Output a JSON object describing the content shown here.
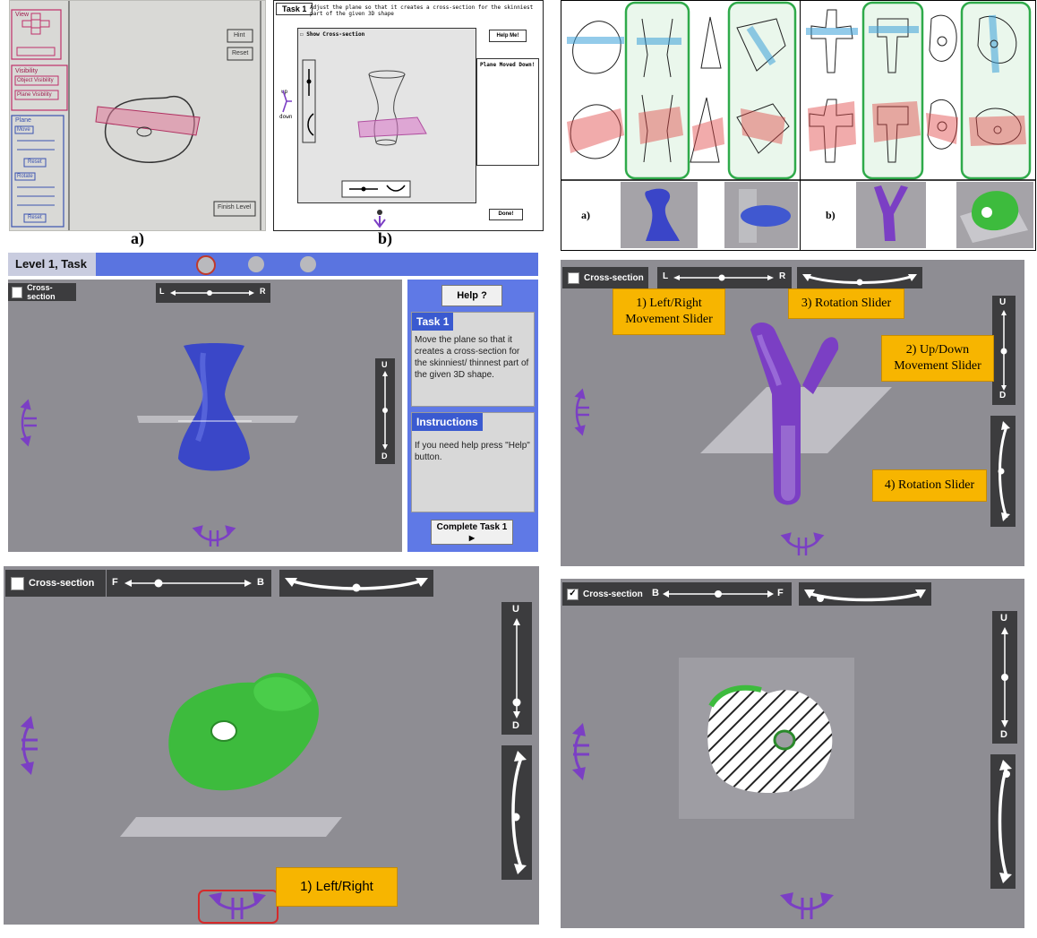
{
  "captions": {
    "top_sketch": "a)",
    "top_wireframe": "b)",
    "panel_a": "a)",
    "panel_b": "b)"
  },
  "paper_sketch": {
    "labels": [
      "View",
      "Hint",
      "Reset",
      "Visibility",
      "Object Visibility",
      "Plane Visibility",
      "Plane",
      "Move",
      "Reset",
      "Rotate",
      "Reset",
      "Finish Level"
    ]
  },
  "wireframe": {
    "task_title": "Task 1",
    "task_instruction": "Adjust the plane so that it creates a cross-section for the skinniest part of the given 3D shape",
    "show_cross_section": "Show Cross-section",
    "help_button": "Help Me!",
    "message": "Plane Moved Down!",
    "up_label": "up",
    "down_label": "down",
    "done_button": "Done!"
  },
  "game_main": {
    "level_title": "Level 1, Task",
    "cross_section_label": "Cross-section",
    "slider_left": "L",
    "slider_right": "R",
    "slider_up": "U",
    "slider_down": "D",
    "help_button": "Help ?",
    "task_header": "Task 1",
    "task_text": "Move the plane so that it creates a cross-section for the skinniest/ thinnest part of the given 3D shape.",
    "instructions_header": "Instructions",
    "instructions_text": "If you need help press \"Help\" button.",
    "complete_button": "Complete Task 1",
    "complete_arrow": "▶",
    "progress_dots": 3
  },
  "game_y": {
    "cross_section_label": "Cross-section",
    "slider_left": "L",
    "slider_right": "R",
    "slider_up": "U",
    "slider_down": "D",
    "callout_1": "1) Left/Right Movement Slider",
    "callout_2": "2) Up/Down Movement Slider",
    "callout_3": "3) Rotation Slider",
    "callout_4": "4) Rotation Slider"
  },
  "game_green": {
    "cross_section_label": "Cross-section",
    "slider_left": "F",
    "slider_right": "B",
    "slider_up": "U",
    "slider_down": "D",
    "callout": "1)   Left/Right"
  },
  "game_hatched": {
    "cross_section_label": "Cross-section",
    "slider_left": "B",
    "slider_right": "F",
    "slider_up": "U",
    "slider_down": "D",
    "checked": true
  },
  "colors": {
    "scene": "#8e8d93",
    "callout": "#f7b500",
    "accent_blue": "#3a5ad0",
    "header_bar": "#5a74e0",
    "purple": "#7b3fc4",
    "sketch_green": "#2faa4a"
  }
}
